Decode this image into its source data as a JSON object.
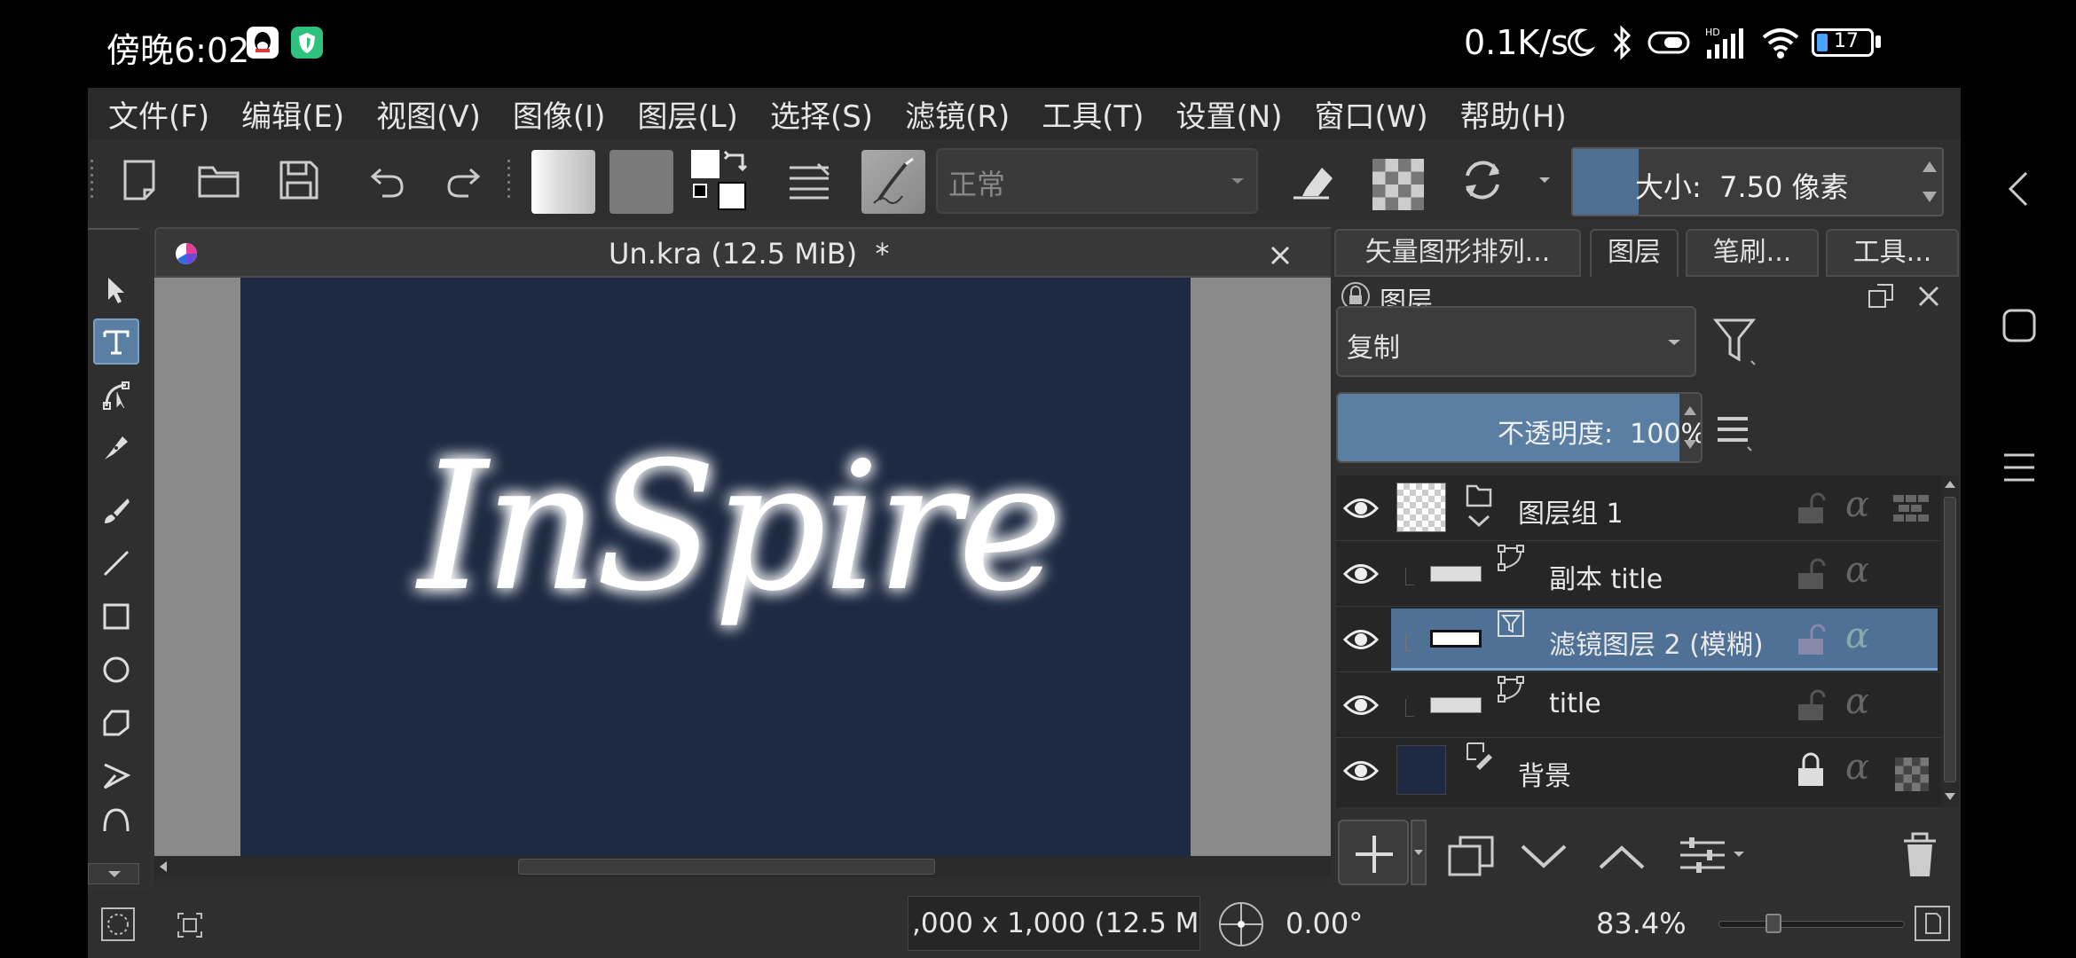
{
  "status_bar": {
    "time": "傍晚6:02",
    "network_speed": "0.1K/s",
    "battery": "17"
  },
  "menu": [
    "文件(F)",
    "编辑(E)",
    "视图(V)",
    "图像(I)",
    "图层(L)",
    "选择(S)",
    "滤镜(R)",
    "工具(T)",
    "设置(N)",
    "窗口(W)",
    "帮助(H)"
  ],
  "toolbar": {
    "blend_mode": "正常",
    "brush_size": "大小:  7.50 像素",
    "brush_color": "#4e6f91"
  },
  "document": {
    "title": "Un.kra (12.5 MiB)  *",
    "canvas_text": "InSpire",
    "canvas_color": "#1d2a42"
  },
  "panel": {
    "tabs": [
      "矢量图形排列...",
      "图层",
      "笔刷...",
      "工具..."
    ],
    "header": "图层",
    "blend_mode": "复制",
    "opacity": "不透明度:  100%",
    "layers": [
      {
        "name": "图层组 1",
        "selected": false,
        "locked": false
      },
      {
        "name": "副本 title",
        "selected": false,
        "locked": false
      },
      {
        "name": "滤镜图层 2 (模糊)",
        "selected": true,
        "locked": false
      },
      {
        "name": "title",
        "selected": false,
        "locked": false
      },
      {
        "name": "背景",
        "selected": false,
        "locked": true
      }
    ]
  },
  "bottom": {
    "image_size": ",000 x 1,000 (12.5 MiB",
    "rotation": "0.00°",
    "zoom": "83.4%"
  },
  "colors": {
    "accent": "#5a7fa3",
    "selected_row": "#4f7196"
  }
}
